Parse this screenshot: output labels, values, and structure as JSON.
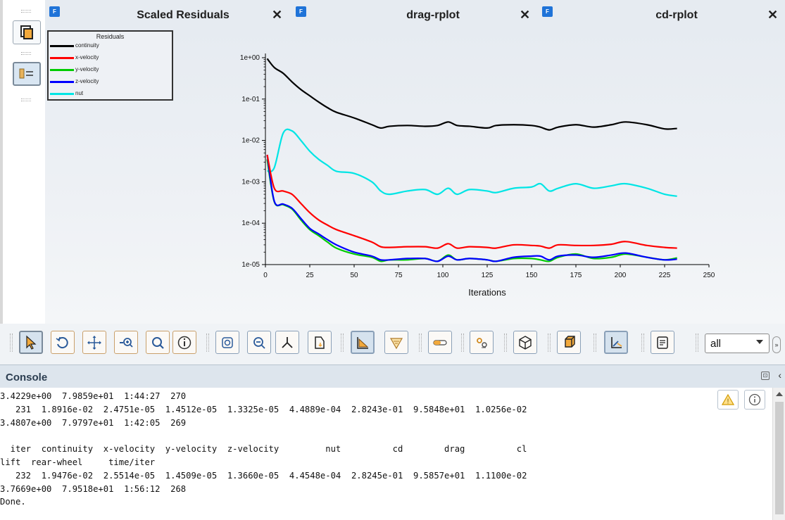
{
  "tabs": [
    {
      "title": "Scaled Residuals",
      "icon": "fluent-doc-icon",
      "close": "✕"
    },
    {
      "title": "drag-rplot",
      "icon": "fluent-doc-icon",
      "close": "✕"
    },
    {
      "title": "cd-rplot",
      "icon": "fluent-doc-icon",
      "close": "✕"
    }
  ],
  "left_toolbar": {
    "buttons": [
      {
        "icon": "page-layout-icon"
      },
      {
        "icon": "legend-toggle-icon"
      }
    ]
  },
  "legend": {
    "title": "Residuals",
    "items": [
      {
        "label": "continuity",
        "color": "#000000"
      },
      {
        "label": "x-velocity",
        "color": "#ff0000"
      },
      {
        "label": "y-velocity",
        "color": "#00cc00"
      },
      {
        "label": "z-velocity",
        "color": "#0000ff"
      },
      {
        "label": "nut",
        "color": "#00e5e5"
      }
    ]
  },
  "chart_data": {
    "type": "line",
    "title": "",
    "xlabel": "Iterations",
    "ylabel": "",
    "xlim": [
      0,
      250
    ],
    "ylim": [
      1e-05,
      1
    ],
    "yscale": "log",
    "grid": false,
    "legend_position": "top-left",
    "x_ticks": [
      "0",
      "25",
      "50",
      "75",
      "100",
      "125",
      "150",
      "175",
      "200",
      "225",
      "250"
    ],
    "y_ticks": [
      "1e+00",
      "1e-01",
      "1e-02",
      "1e-03",
      "1e-04",
      "1e-05"
    ],
    "x": [
      1,
      5,
      10,
      15,
      20,
      25,
      30,
      35,
      40,
      50,
      60,
      65,
      70,
      80,
      90,
      97,
      103,
      108,
      115,
      125,
      130,
      140,
      150,
      155,
      160,
      165,
      175,
      185,
      195,
      203,
      215,
      225,
      232
    ],
    "series": [
      {
        "name": "continuity",
        "color": "#000000",
        "values": [
          0.95,
          0.58,
          0.42,
          0.26,
          0.17,
          0.12,
          0.085,
          0.062,
          0.048,
          0.035,
          0.024,
          0.02,
          0.022,
          0.023,
          0.022,
          0.023,
          0.028,
          0.023,
          0.022,
          0.02,
          0.023,
          0.024,
          0.023,
          0.021,
          0.018,
          0.021,
          0.024,
          0.021,
          0.024,
          0.028,
          0.024,
          0.019,
          0.0195
        ]
      },
      {
        "name": "x-velocity",
        "color": "#ff0000",
        "values": [
          0.0045,
          0.0007,
          0.0006,
          0.0005,
          0.0003,
          0.00018,
          0.00012,
          9e-05,
          7e-05,
          5e-05,
          3.5e-05,
          2.7e-05,
          2.6e-05,
          2.7e-05,
          2.7e-05,
          2.5e-05,
          3.2e-05,
          2.5e-05,
          2.7e-05,
          2.6e-05,
          2.5e-05,
          3e-05,
          2.9e-05,
          2.8e-05,
          2.5e-05,
          3e-05,
          2.9e-05,
          2.9e-05,
          3.1e-05,
          3.6e-05,
          2.9e-05,
          2.6e-05,
          2.5e-05
        ]
      },
      {
        "name": "y-velocity",
        "color": "#00cc00",
        "values": [
          0.0035,
          0.00033,
          0.00028,
          0.00022,
          0.00012,
          7e-05,
          5e-05,
          3.5e-05,
          2.5e-05,
          1.8e-05,
          1.5e-05,
          1.2e-05,
          1.3e-05,
          1.3e-05,
          1.4e-05,
          1.2e-05,
          1.7e-05,
          1.3e-05,
          1.4e-05,
          1.3e-05,
          1.2e-05,
          1.4e-05,
          1.4e-05,
          1.3e-05,
          1.2e-05,
          1.5e-05,
          1.8e-05,
          1.4e-05,
          1.5e-05,
          1.8e-05,
          1.5e-05,
          1.3e-05,
          1.45e-05
        ]
      },
      {
        "name": "z-velocity",
        "color": "#0000ff",
        "values": [
          0.0045,
          0.00034,
          0.00029,
          0.00023,
          0.00013,
          7.5e-05,
          5.5e-05,
          4e-05,
          3e-05,
          2e-05,
          1.6e-05,
          1.3e-05,
          1.3e-05,
          1.4e-05,
          1.4e-05,
          1.2e-05,
          1.6e-05,
          1.3e-05,
          1.4e-05,
          1.3e-05,
          1.2e-05,
          1.5e-05,
          1.6e-05,
          1.6e-05,
          1.3e-05,
          1.6e-05,
          1.7e-05,
          1.5e-05,
          1.7e-05,
          1.9e-05,
          1.5e-05,
          1.3e-05,
          1.35e-05
        ]
      },
      {
        "name": "nut",
        "color": "#00e5e5",
        "values": [
          0.0018,
          0.0022,
          0.015,
          0.017,
          0.01,
          0.0055,
          0.0035,
          0.0025,
          0.0018,
          0.0016,
          0.001,
          0.0006,
          0.0005,
          0.0006,
          0.00065,
          0.0005,
          0.0007,
          0.0005,
          0.00065,
          0.0006,
          0.00055,
          0.0007,
          0.00075,
          0.0009,
          0.0006,
          0.0007,
          0.0009,
          0.0007,
          0.0008,
          0.0009,
          0.0007,
          0.0005,
          0.00045
        ]
      }
    ]
  },
  "bottom_toolbar": {
    "buttons": [
      {
        "icon": "select-pointer-icon",
        "selected": true
      },
      {
        "icon": "rotate-icon"
      },
      {
        "icon": "pan-icon"
      },
      {
        "icon": "zoom-in-out-icon"
      },
      {
        "icon": "zoom-to-area-icon"
      },
      {
        "icon": "probe-info-icon"
      },
      {
        "icon": "fit-to-window-icon"
      },
      {
        "icon": "zoom-fit-icon"
      },
      {
        "icon": "axes-view-icon"
      },
      {
        "icon": "view-plane-icon"
      },
      {
        "icon": "plot-mode-icon",
        "selected": true
      },
      {
        "icon": "filter-display-icon"
      },
      {
        "icon": "toggle-slider-icon"
      },
      {
        "icon": "scene-settings-icon"
      },
      {
        "icon": "cube-view-icon"
      },
      {
        "icon": "box-shading-icon"
      },
      {
        "icon": "axes-toggle-icon",
        "selected": true
      },
      {
        "icon": "report-icon"
      }
    ],
    "view_select": {
      "value": "all"
    },
    "overflow_label": "»"
  },
  "console": {
    "title": "Console",
    "lines": [
      "3.4229e+00  7.9859e+01  1:44:27  270",
      "   231  1.8916e-02  2.4751e-05  1.4512e-05  1.3325e-05  4.4889e-04  2.8243e-01  9.5848e+01  1.0256e-02",
      "3.4807e+00  7.9797e+01  1:42:05  269",
      "",
      "  iter  continuity  x-velocity  y-velocity  z-velocity         nut          cd        drag          cl",
      "lift  rear-wheel     time/iter",
      "   232  1.9476e-02  2.5514e-05  1.4509e-05  1.3660e-05  4.4548e-04  2.8245e-01  9.5857e+01  1.1100e-02",
      "3.7669e+00  7.9518e+01  1:56:12  268",
      "Done."
    ],
    "warning_icon": "warning-icon",
    "info_icon": "info-icon"
  }
}
